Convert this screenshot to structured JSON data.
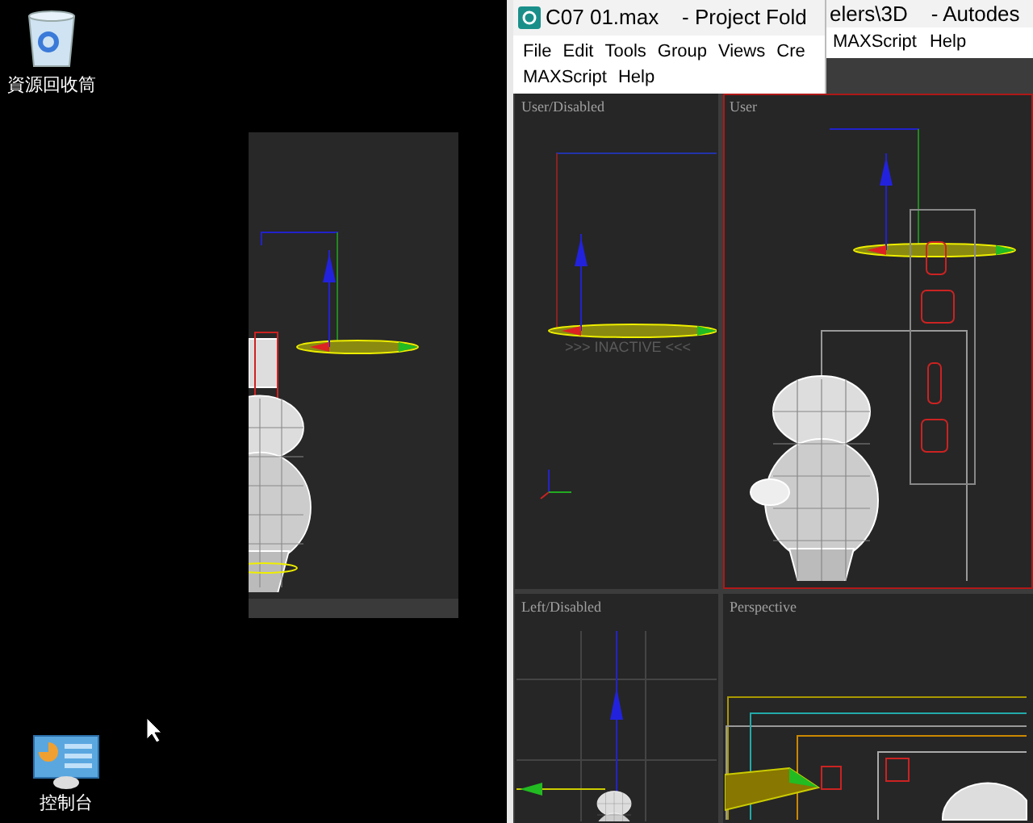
{
  "desktop_icons": [
    {
      "label": "資源回收筒",
      "kind": "recycle"
    },
    {
      "label": "控制台",
      "kind": "control"
    }
  ],
  "front_window": {
    "title": "C07 01.max    - Project Fold",
    "menu_rows": [
      [
        "File",
        "Edit",
        "Tools",
        "Group",
        "Views",
        "Cre"
      ],
      [
        "MAXScript",
        "Help"
      ]
    ]
  },
  "back_window": {
    "title": "elers\\3D    - Autodes",
    "menu": [
      "MAXScript",
      "Help"
    ]
  },
  "viewports": [
    {
      "label": "User/Disabled",
      "selected": false,
      "kind": "user_disabled",
      "inactive_label": ">>> INACTIVE <<<"
    },
    {
      "label": "User",
      "selected": true,
      "kind": "user"
    },
    {
      "label": "Left/Disabled",
      "selected": false,
      "kind": "left"
    },
    {
      "label": "Perspective",
      "selected": false,
      "kind": "perspective"
    }
  ]
}
